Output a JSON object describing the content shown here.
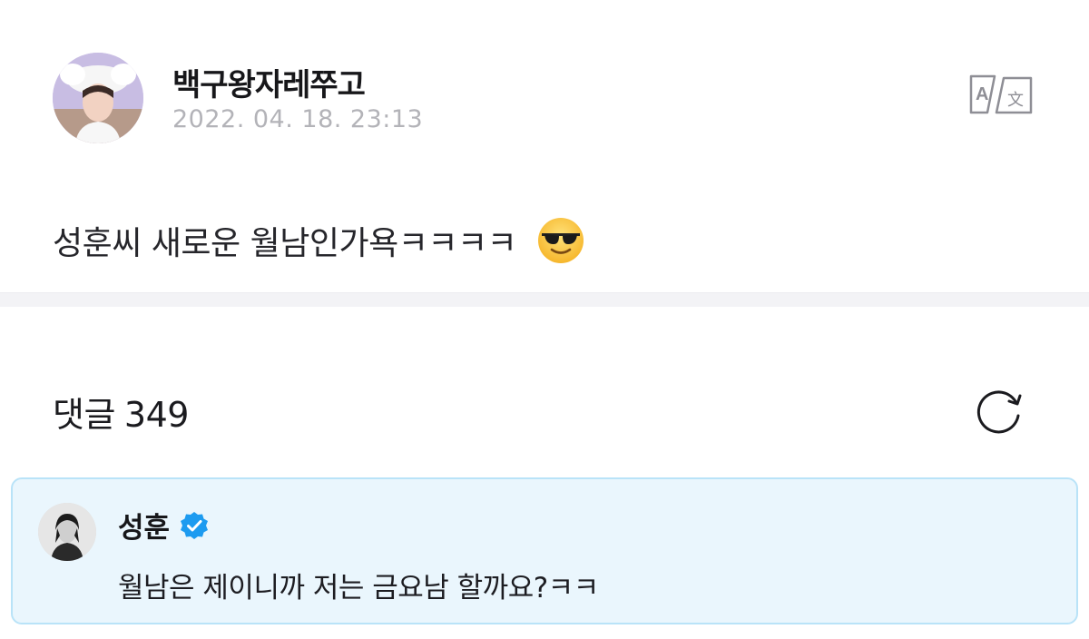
{
  "post": {
    "author": "백구왕자레쭈고",
    "date": "2022. 04. 18. 23:13",
    "text": "성훈씨 새로운 월남인가욕ㅋㅋㅋㅋ",
    "emoji_icon": "smiling-face-with-sunglasses-icon",
    "translate_icon": "translate-icon"
  },
  "comments": {
    "label": "댓글",
    "count": "349",
    "refresh_icon": "refresh-icon"
  },
  "artist_comment": {
    "author": "성훈",
    "verified_icon": "verified-badge-icon",
    "text": "월남은 제이니까 저는 금요남 할까요?ㅋㅋ"
  },
  "colors": {
    "card_background": "#eaf6fd",
    "card_border": "#b9e3f8",
    "verified_blue": "#1d9bf0",
    "date_gray": "#b3b3b8"
  }
}
